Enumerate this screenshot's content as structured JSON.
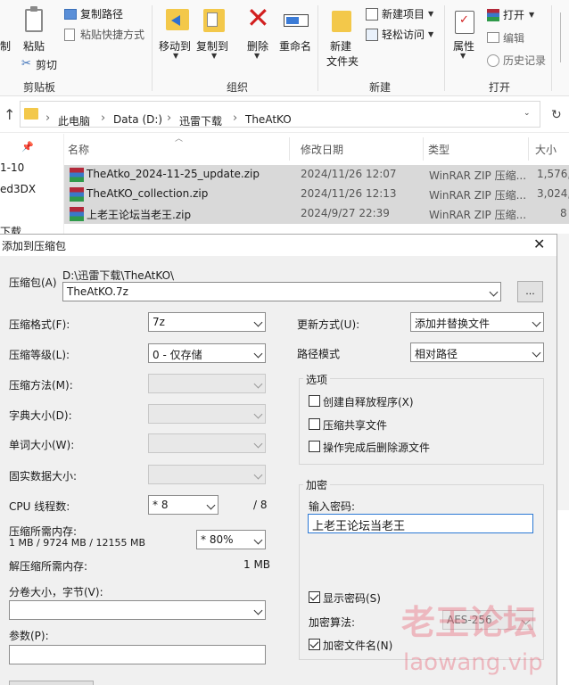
{
  "ribbon": {
    "clipboard": {
      "pin_label": "制",
      "paste_label": "粘贴",
      "copy_path": "复制路径",
      "paste_shortcut": "粘贴快捷方式",
      "cut": "剪切",
      "group": "剪贴板"
    },
    "organize": {
      "move_to": "移动到",
      "copy_to": "复制到",
      "delete": "删除",
      "rename": "重命名",
      "group": "组织"
    },
    "new": {
      "new_folder_line1": "新建",
      "new_folder_line2": "文件夹",
      "new_item": "新建项目",
      "easy_access": "轻松访问",
      "group": "新建"
    },
    "open": {
      "properties": "属性",
      "open": "打开",
      "edit": "编辑",
      "history": "历史记录",
      "group": "打开"
    }
  },
  "address": {
    "crumbs": [
      "此电脑",
      "Data (D:)",
      "迅雷下载",
      "TheAtKO"
    ]
  },
  "nav_pane": {
    "items": [
      "1-10",
      "ed3DX",
      "下载"
    ]
  },
  "file_list": {
    "columns": {
      "name": "名称",
      "date": "修改日期",
      "type": "类型",
      "size": "大小"
    },
    "rows": [
      {
        "name": "TheAtko_2024-11-25_update.zip",
        "date": "2024/11/26 12:07",
        "type": "WinRAR ZIP 压缩...",
        "size": "1,576,"
      },
      {
        "name": "TheAtKO_collection.zip",
        "date": "2024/11/26 12:13",
        "type": "WinRAR ZIP 压缩...",
        "size": "3,024,"
      },
      {
        "name": "上老王论坛当老王.zip",
        "date": "2024/9/27 22:39",
        "type": "WinRAR ZIP 压缩...",
        "size": "8"
      }
    ]
  },
  "dialog": {
    "title": "添加到压缩包",
    "archive_label": "压缩包(A)",
    "archive_dir": "D:\\迅雷下载\\TheAtKO\\",
    "archive_name": "TheAtKO.7z",
    "browse": "...",
    "format_label": "压缩格式(F):",
    "format_value": "7z",
    "level_label": "压缩等级(L):",
    "level_value": "0 - 仅存储",
    "method_label": "压缩方法(M):",
    "dict_label": "字典大小(D):",
    "word_label": "单词大小(W):",
    "solid_label": "固实数据大小:",
    "cpu_label": "CPU 线程数:",
    "cpu_value": "* 8",
    "cpu_max": "/ 8",
    "mem_label": "压缩所需内存:",
    "mem_detail": "1 MB / 9724 MB / 12155 MB",
    "mem_pct": "* 80%",
    "decomp_label": "解压缩所需内存:",
    "decomp_value": "1 MB",
    "split_label": "分卷大小，字节(V):",
    "params_label": "参数(P):",
    "update_label": "更新方式(U):",
    "update_value": "添加并替换文件",
    "path_label": "路径模式",
    "path_value": "相对路径",
    "options_title": "选项",
    "opt_sfx": "创建自释放程序(X)",
    "opt_shared": "压缩共享文件",
    "opt_delete": "操作完成后删除源文件",
    "enc_title": "加密",
    "enc_pw_label": "输入密码:",
    "enc_pw_value": "上老王论坛当老王",
    "show_pw": "显示密码(S)",
    "algo_label": "加密算法:",
    "algo_value": "AES-256",
    "enc_names": "加密文件名(N)"
  },
  "watermark": {
    "line1": "老王论坛",
    "line2": "laowang.vip"
  }
}
